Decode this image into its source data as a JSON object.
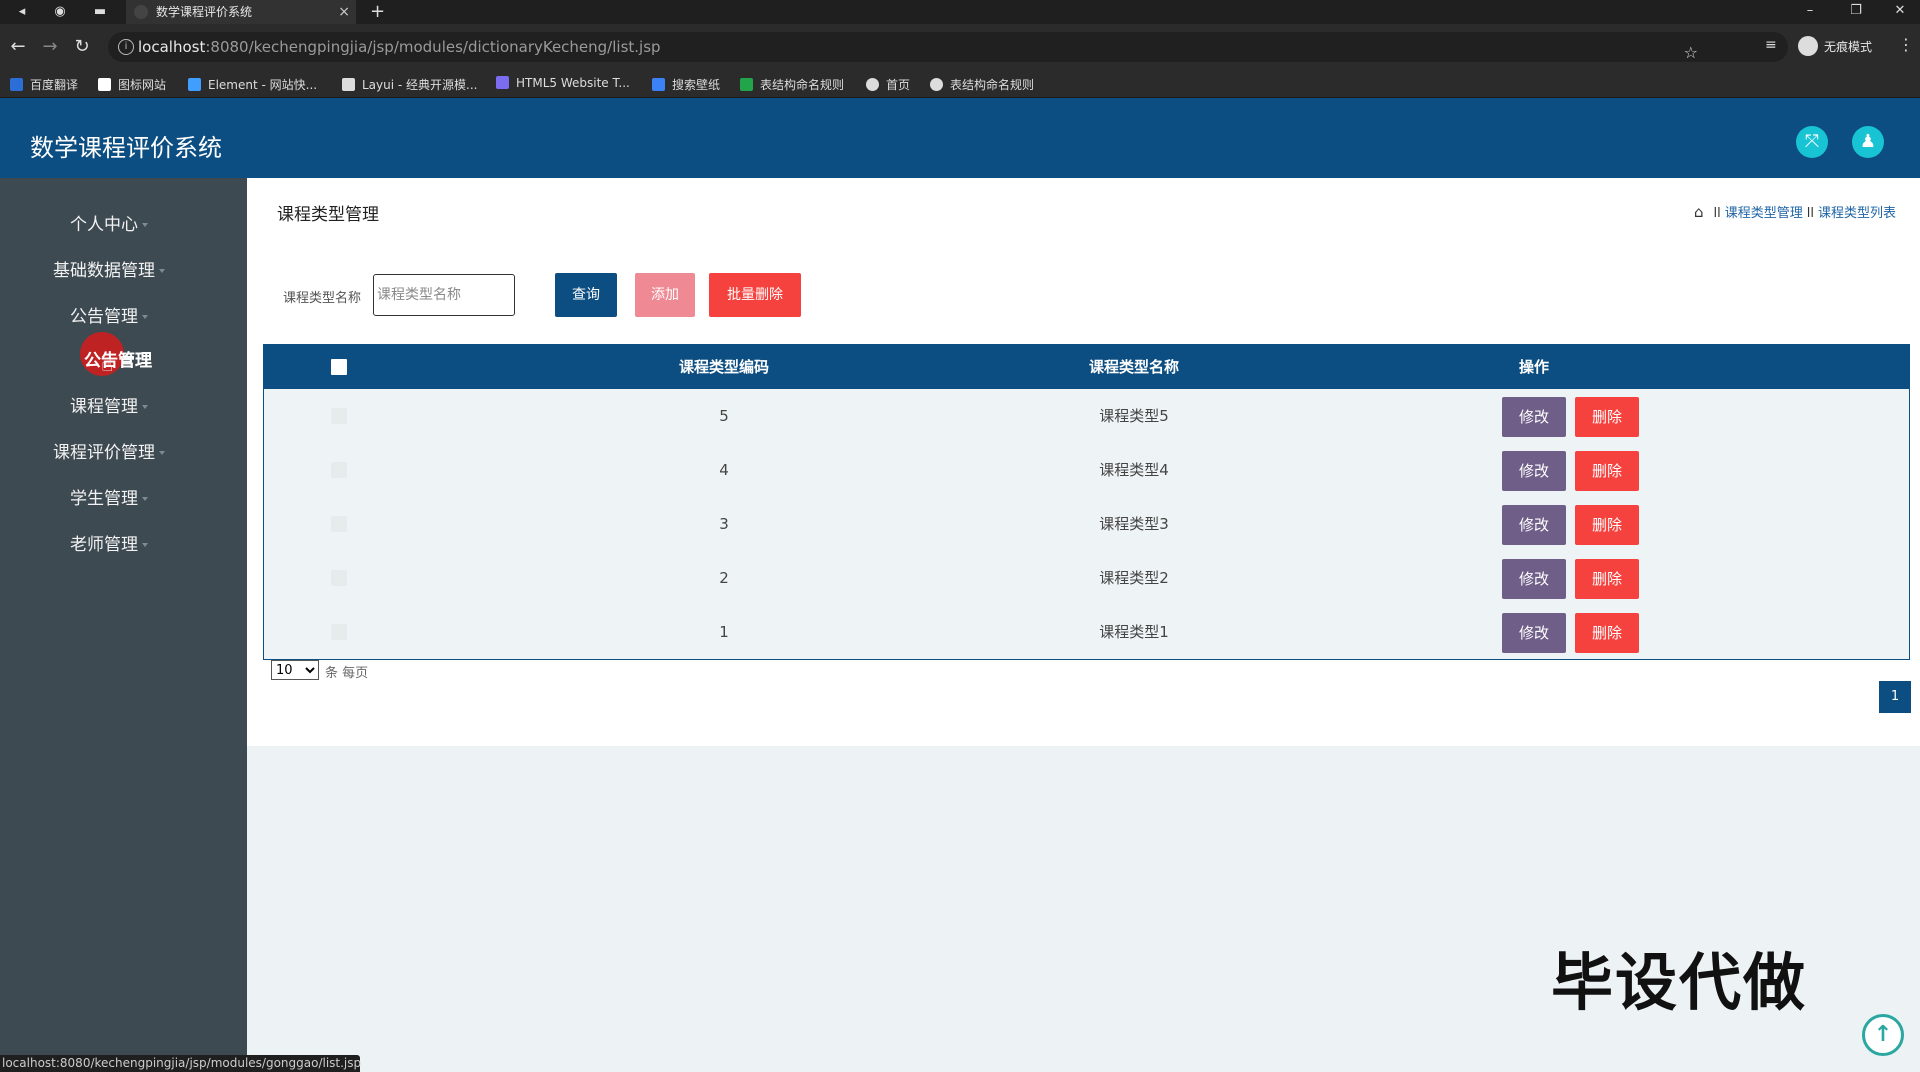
{
  "browser": {
    "tab_title": "数学课程评价系统",
    "tab_close": "×",
    "new_tab": "+",
    "url_host": "localhost",
    "url_path": ":8080/kechengpingjia/jsp/modules/dictionaryKecheng/list.jsp",
    "incognito_label": "无痕模式",
    "bookmarks": [
      {
        "label": "百度翻译",
        "color": "#2b6fd6"
      },
      {
        "label": "图标网站",
        "color": "#ffffff"
      },
      {
        "label": "Element - 网站快...",
        "color": "#409eff"
      },
      {
        "label": "Layui - 经典开源模...",
        "color": "#dddddd"
      },
      {
        "label": "HTML5 Website T...",
        "color": "#7c6cf0"
      },
      {
        "label": "搜索壁纸",
        "color": "#3b82f6"
      },
      {
        "label": "表结构命名规则",
        "color": "#22a44a"
      },
      {
        "label": "首页",
        "color": "#dddddd"
      },
      {
        "label": "表结构命名规则",
        "color": "#dddddd"
      }
    ],
    "status_url": "localhost:8080/kechengpingjia/jsp/modules/gonggao/list.jsp"
  },
  "header": {
    "title": "数学课程评价系统"
  },
  "sidebar": {
    "items": [
      {
        "label": "个人中心"
      },
      {
        "label": "基础数据管理"
      },
      {
        "label": "公告管理"
      },
      {
        "label": "课程管理"
      },
      {
        "label": "课程评价管理"
      },
      {
        "label": "学生管理"
      },
      {
        "label": "老师管理"
      }
    ],
    "sub_item": "公告管理"
  },
  "main": {
    "page_title": "课程类型管理",
    "breadcrumb": [
      "课程类型管理",
      "课程类型列表"
    ],
    "breadcrumb_sep": "ll",
    "search": {
      "label": "课程类型名称",
      "placeholder": "课程类型名称",
      "value": ""
    },
    "buttons": {
      "query": "查询",
      "add": "添加",
      "batch_delete": "批量删除"
    },
    "table": {
      "columns": [
        "课程类型编码",
        "课程类型名称",
        "操作"
      ],
      "rows": [
        {
          "code": "5",
          "name": "课程类型5"
        },
        {
          "code": "4",
          "name": "课程类型4"
        },
        {
          "code": "3",
          "name": "课程类型3"
        },
        {
          "code": "2",
          "name": "课程类型2"
        },
        {
          "code": "1",
          "name": "课程类型1"
        }
      ],
      "edit_label": "修改",
      "delete_label": "删除"
    },
    "pagination": {
      "page_size": "10",
      "page_size_label": "条 每页",
      "current_page": "1"
    }
  },
  "watermark": "毕设代做",
  "colors": {
    "primary": "#0d4e82",
    "sidebar": "#3e4a52",
    "accent_cyan": "#18c3d3",
    "danger": "#f5423f",
    "edit": "#6f5e88"
  }
}
